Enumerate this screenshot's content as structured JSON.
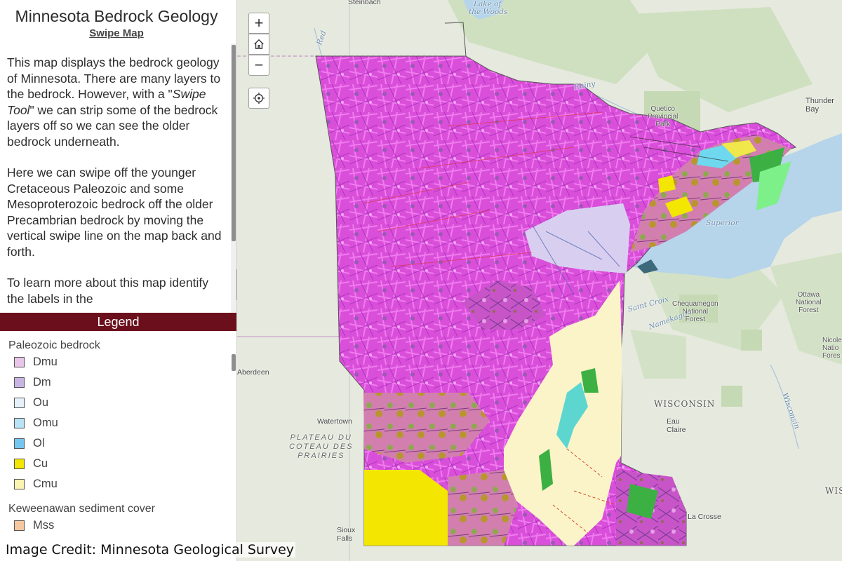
{
  "panel": {
    "title": "Minnesota Bedrock Geology",
    "subtitle": "Swipe Map",
    "paragraph1_a": "This map displays the bedrock geology of Minnesota. There are many layers to the bedrock. However, with a \"",
    "paragraph1_em": "Swipe Tool",
    "paragraph1_b": "\" we can strip some of the bedrock layers off so we can see the older bedrock underneath.",
    "paragraph2": "Here we can swipe off the younger Cretaceous Paleozoic and some Mesoproterozoic bedrock off the older Precambrian bedrock by moving the vertical swipe line on the map back and forth.",
    "paragraph3": "To learn more about this map identify the labels in the"
  },
  "legend": {
    "header": "Legend",
    "groups": [
      {
        "title": "Paleozoic bedrock",
        "items": [
          {
            "label": "Dmu",
            "color": "#e9c6e9"
          },
          {
            "label": "Dm",
            "color": "#c8b4e2"
          },
          {
            "label": "Ou",
            "color": "#e6f2fb"
          },
          {
            "label": "Omu",
            "color": "#b9e2f7"
          },
          {
            "label": "Ol",
            "color": "#74c7ef"
          },
          {
            "label": "Cu",
            "color": "#f3e600"
          },
          {
            "label": "Cmu",
            "color": "#fbf4b0"
          }
        ]
      },
      {
        "title": "Keweenawan sediment cover",
        "items": [
          {
            "label": "Mss",
            "color": "#f6c8a0"
          }
        ]
      }
    ]
  },
  "map": {
    "controls": {
      "zoom_in": "+",
      "zoom_out": "−"
    },
    "places": {
      "steinbach": "Steinbach",
      "lake_of_woods_1": "Lake of",
      "lake_of_woods_2": "the Woods",
      "red": "Red",
      "rainy": "Rainy",
      "quetico_1": "Quetico",
      "quetico_2": "Provincial",
      "quetico_3": "Park",
      "thunder_bay_1": "Thunder",
      "thunder_bay_2": "Bay",
      "superior": "Superior",
      "lake": "Lake",
      "aberdeen": "Aberdeen",
      "watertown": "Watertown",
      "plateau_1": "PLATEAU DU",
      "plateau_2": "COTEAU DES",
      "plateau_3": "PRAIRIES",
      "wisconsin": "WISCONSIN",
      "eau_claire_1": "Eau",
      "eau_claire_2": "Claire",
      "la_crosse": "La Crosse",
      "sioux_falls_1": "Sioux",
      "sioux_falls_2": "Falls",
      "saint_croix": "Saint Croix",
      "namekagon": "Namekagon",
      "wisconsin_river": "Wisconsin",
      "chequamegon_1": "Chequamegon",
      "chequamegon_2": "National",
      "chequamegon_3": "Forest",
      "ottawa_1": "Ottawa",
      "ottawa_2": "National",
      "ottawa_3": "Forest",
      "nicolet_1": "Nicole",
      "nicolet_2": "Natio",
      "nicolet_3": "Fores",
      "wis_edge": "WIS"
    }
  },
  "credit": "Image Credit: Minnesota Geological Survey"
}
